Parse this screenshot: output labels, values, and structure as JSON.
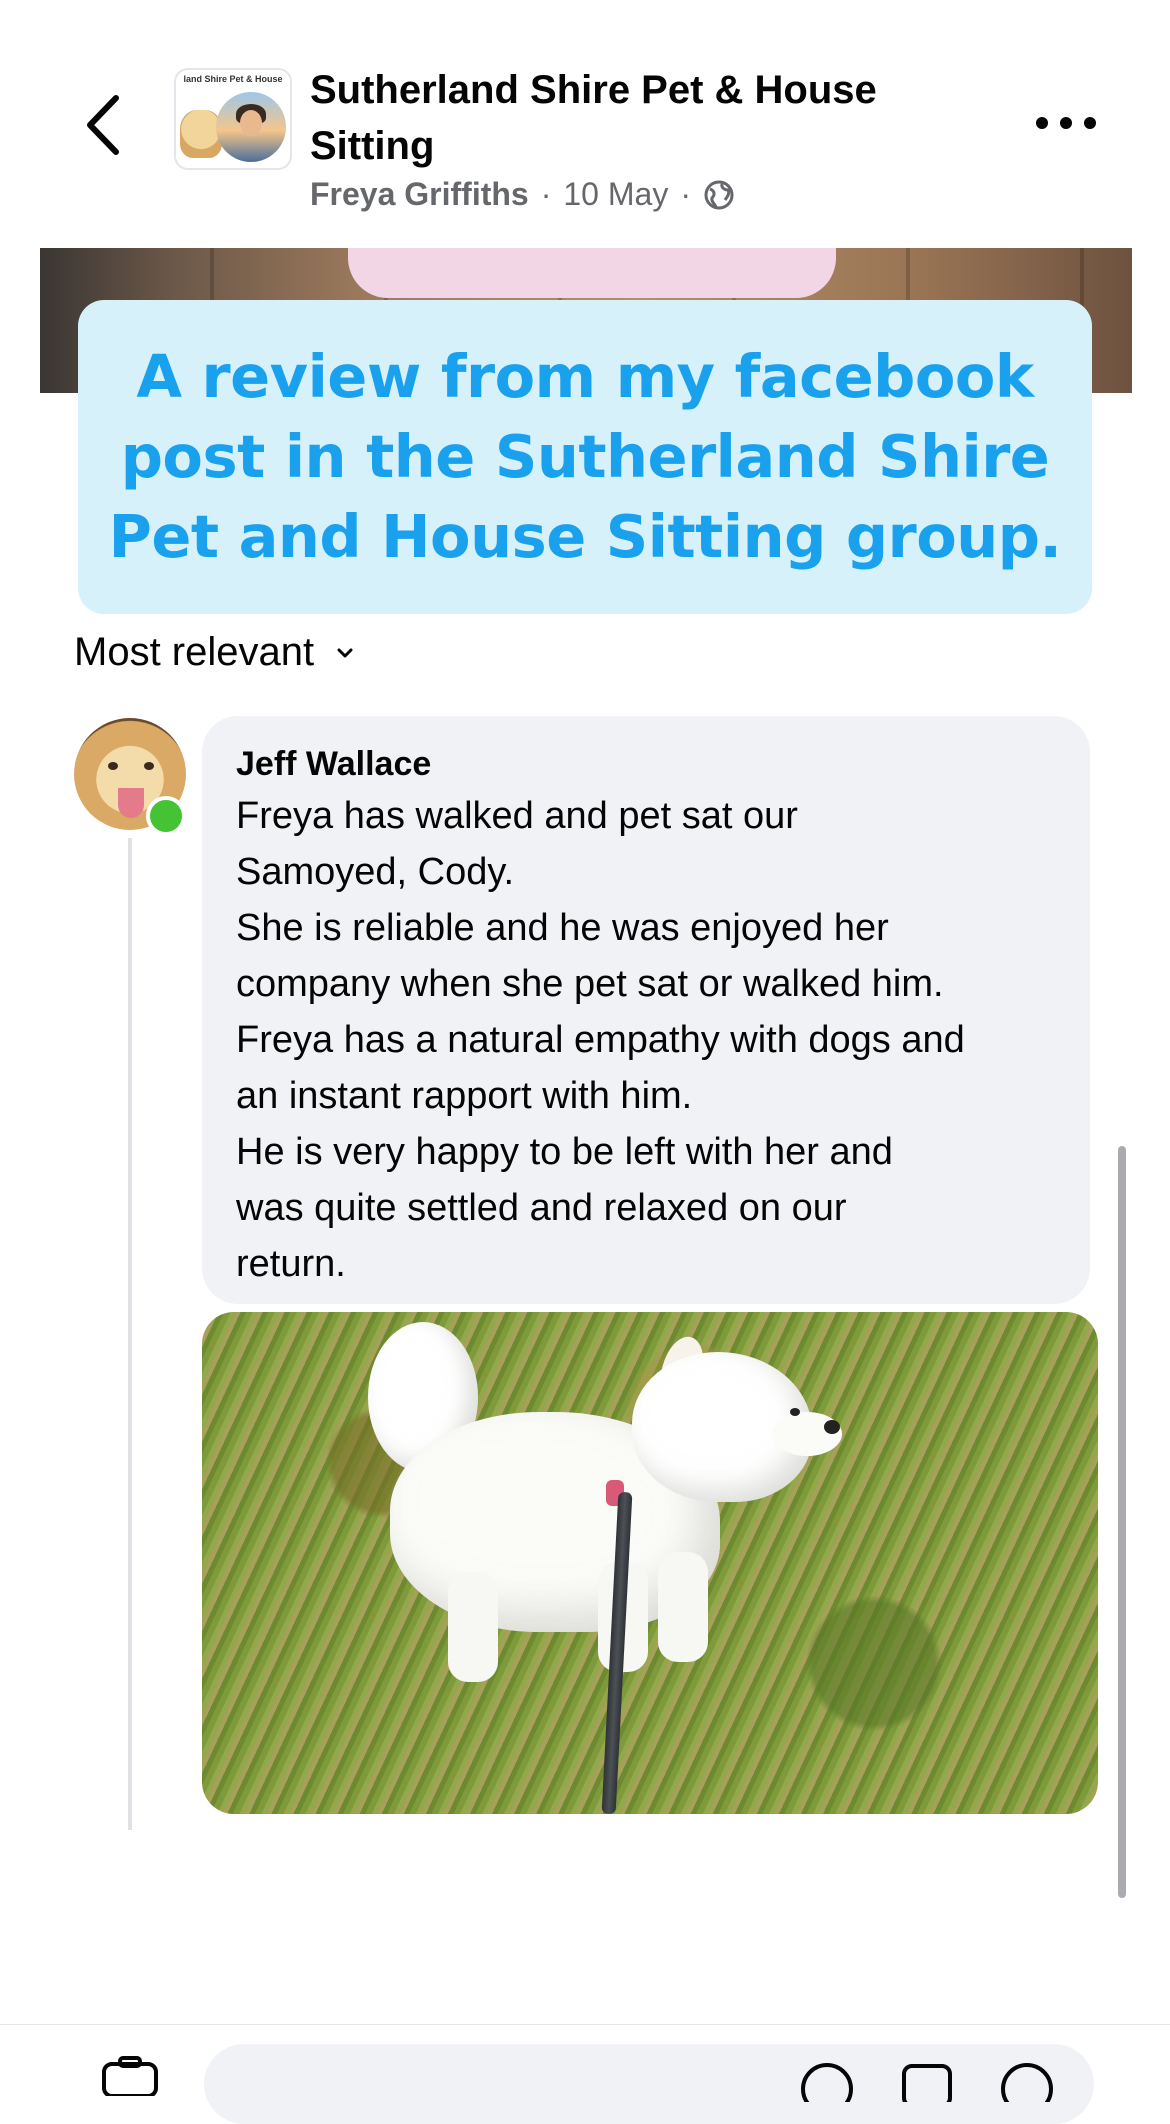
{
  "header": {
    "group_thumb_banner": "land Shire Pet & House",
    "group_name": "Sutherland Shire Pet & House Sitting",
    "author": "Freya Griffiths",
    "separator": "·",
    "date": "10 May"
  },
  "caption": {
    "text": "A review from my facebook post in the Sutherland Shire Pet and House Sitting group."
  },
  "comments_sort": {
    "label": "Most relevant"
  },
  "comment": {
    "author": "Jeff Wallace",
    "online": true,
    "text": "Freya has walked and pet sat our\nSamoyed, Cody.\nShe is reliable and he was enjoyed her\ncompany when she pet sat or walked him.\nFreya has a natural empathy with dogs and\nan instant rapport with him.\nHe is very happy to be left with her and\nwas quite settled and relaxed on our\nreturn."
  },
  "colors": {
    "caption_text": "#1aa1ee",
    "caption_bg": "#d7f1fb",
    "bubble_bg": "#f0f2f5",
    "online_green": "#44c335",
    "meta_grey": "#65676b"
  },
  "icons": [
    "back-chevron-icon",
    "globe-icon",
    "more-options-icon",
    "chevron-down-icon",
    "camera-icon",
    "emoji-icon",
    "gif-icon",
    "sticker-icon"
  ]
}
